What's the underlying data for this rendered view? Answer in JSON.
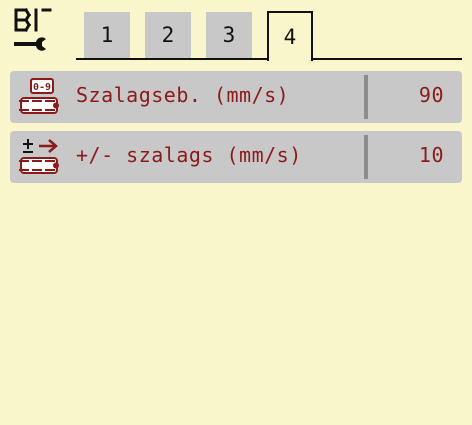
{
  "tabs": [
    {
      "label": "1",
      "active": false
    },
    {
      "label": "2",
      "active": false
    },
    {
      "label": "3",
      "active": false
    },
    {
      "label": "4",
      "active": true
    }
  ],
  "rows": [
    {
      "icon": "belt-speed-range-icon",
      "icon_text": "0-9",
      "label": "Szalagseb. (mm/s)",
      "value": "90"
    },
    {
      "icon": "belt-speed-adjust-icon",
      "label": "+/- szalags (mm/s)",
      "value": "10"
    }
  ],
  "colors": {
    "background": "#faf6cc",
    "panel": "#c8c8c8",
    "text": "#8b1a1a",
    "separator": "#8c8c8c",
    "outline": "#111111"
  }
}
